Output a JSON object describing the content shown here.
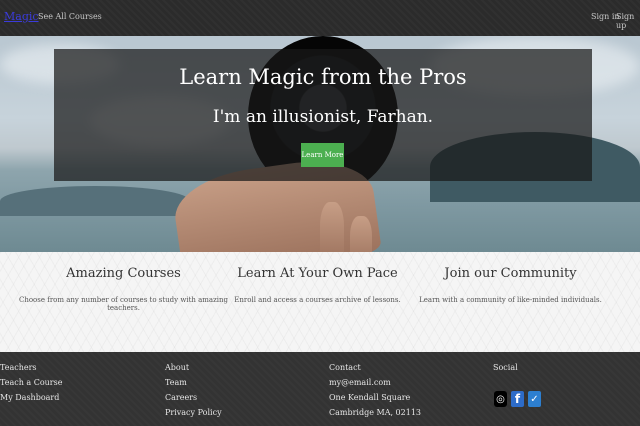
{
  "nav": {
    "brand": "Magic",
    "courses_link": "See All Courses",
    "sign_in": "Sign in",
    "sign_up": "Sign up"
  },
  "hero": {
    "title": "Learn Magic from the Pros",
    "subtitle": "I'm an illusionist, Farhan.",
    "button": "Learn More"
  },
  "features": [
    {
      "title": "Amazing Courses",
      "text": "Choose from any number of courses to study with amazing teachers."
    },
    {
      "title": "Learn At Your Own Pace",
      "text": "Enroll and access a courses archive of lessons."
    },
    {
      "title": "Join our Community",
      "text": "Learn with a community of like-minded individuals."
    }
  ],
  "footer": {
    "col1": [
      "Teachers",
      "Teach a Course",
      "My Dashboard"
    ],
    "col2": [
      "About",
      "Team",
      "Careers",
      "Privacy Policy"
    ],
    "col3": [
      "Contact",
      "my@email.com",
      "One Kendall Square",
      "Cambridge MA, 02113"
    ],
    "social_heading": "Social",
    "social_icons": [
      "github-icon",
      "facebook-icon",
      "twitter-icon"
    ]
  },
  "colors": {
    "brand_link": "#3b3bdc",
    "button_green": "#4caf50",
    "navbar_bg": "#2b2b2b",
    "footer_bg": "#333333"
  }
}
